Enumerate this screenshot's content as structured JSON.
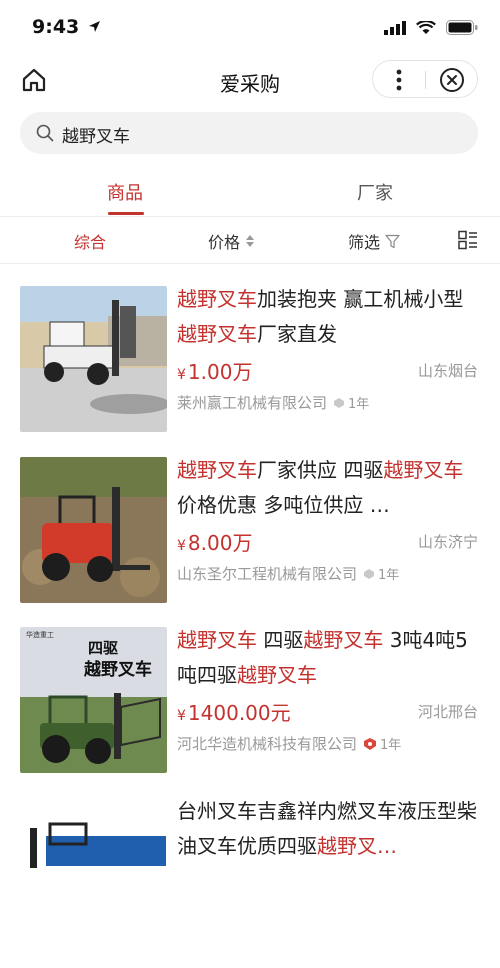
{
  "status_bar": {
    "time": "9:43"
  },
  "nav": {
    "title": "爱采购"
  },
  "search": {
    "query": "越野叉车"
  },
  "tabs": [
    {
      "label": "商品"
    },
    {
      "label": "厂家"
    }
  ],
  "filters": {
    "sort_default": "综合",
    "price": "价格",
    "filter": "筛选"
  },
  "products": [
    {
      "title": [
        {
          "t": "越野叉车",
          "hl": true
        },
        {
          "t": "加装抱夹 赢工机械小型",
          "hl": false
        },
        {
          "t": "越野叉车",
          "hl": true
        },
        {
          "t": "厂家直发",
          "hl": false
        }
      ],
      "price_symbol": "¥",
      "price": "1.00万",
      "location": "山东烟台",
      "company": "莱州赢工机械有限公司",
      "years": "1年"
    },
    {
      "title": [
        {
          "t": "越野叉车",
          "hl": true
        },
        {
          "t": "厂家供应 四驱",
          "hl": false
        },
        {
          "t": "越野叉车",
          "hl": true
        },
        {
          "t": "价格优惠 多吨位供应 …",
          "hl": false
        }
      ],
      "price_symbol": "¥",
      "price": "8.00万",
      "location": "山东济宁",
      "company": "山东圣尔工程机械有限公司",
      "years": "1年"
    },
    {
      "title": [
        {
          "t": "越野叉车",
          "hl": true
        },
        {
          "t": " 四驱",
          "hl": false
        },
        {
          "t": "越野叉车",
          "hl": true
        },
        {
          "t": " 3吨4吨5吨四驱",
          "hl": false
        },
        {
          "t": "越野叉车",
          "hl": true
        }
      ],
      "price_symbol": "¥",
      "price": "1400.00元",
      "location": "河北邢台",
      "company": "河北华造机械科技有限公司",
      "years": "1年",
      "image_text": {
        "brand": "华造重工",
        "line1": "四驱",
        "line2": "越野叉车"
      }
    },
    {
      "title": [
        {
          "t": "台州叉车吉鑫祥内燃叉车液压型柴油叉车优质四驱",
          "hl": false
        },
        {
          "t": "越野叉…",
          "hl": true
        }
      ],
      "price_symbol": "",
      "price": "",
      "location": "",
      "company": "",
      "years": ""
    }
  ],
  "colors": {
    "accent": "#c3322e",
    "muted": "#999999"
  },
  "icons": [
    "home-icon",
    "more-icon",
    "close-circle-icon",
    "search-icon",
    "sort-arrows-icon",
    "funnel-icon",
    "list-layout-icon",
    "badge-icon"
  ]
}
